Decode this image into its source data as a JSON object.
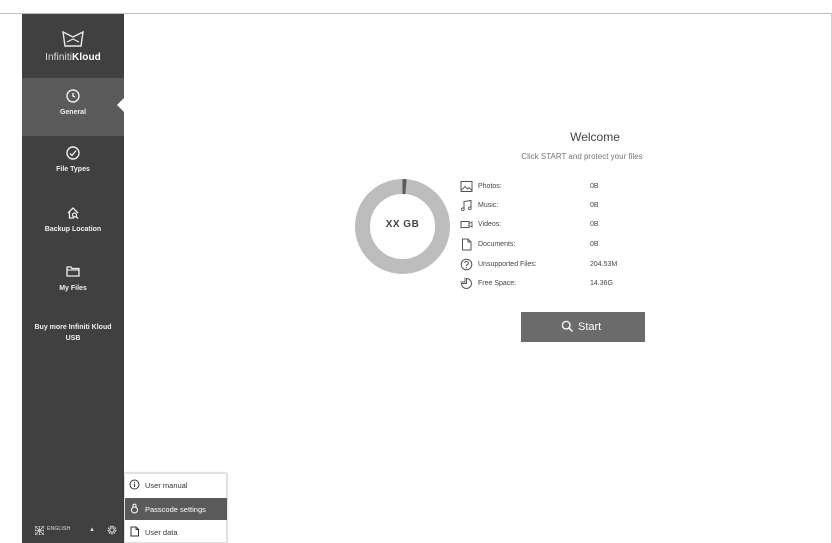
{
  "app": {
    "logo_prefix": "Infiniti",
    "logo_suffix": "Kloud"
  },
  "sidebar": {
    "items": [
      {
        "label": "General",
        "icon": "clock-icon",
        "active": true
      },
      {
        "label": "File Types",
        "icon": "check-circle-icon",
        "active": false
      },
      {
        "label": "Backup Location",
        "icon": "home-search-icon",
        "active": false
      },
      {
        "label": "My Files",
        "icon": "folder-icon",
        "active": false
      }
    ],
    "buy_more": "Buy more Infiniti Kloud USB",
    "language": "ENGLISH"
  },
  "popup_menu": {
    "items": [
      {
        "label": "User manual",
        "icon": "info-icon"
      },
      {
        "label": "Passcode settings",
        "icon": "lock-icon"
      },
      {
        "label": "User data",
        "icon": "document-icon"
      }
    ],
    "hovered_index": 1
  },
  "main": {
    "title": "Welcome",
    "subtitle": "Click START and protect your files",
    "donut_label": "XX GB",
    "used_fraction": 0.014,
    "stats": [
      {
        "label": "Photos:",
        "value": "0B",
        "icon": "image-icon"
      },
      {
        "label": "Music:",
        "value": "0B",
        "icon": "music-icon"
      },
      {
        "label": "Videos:",
        "value": "0B",
        "icon": "video-icon"
      },
      {
        "label": "Documents:",
        "value": "0B",
        "icon": "document-icon"
      },
      {
        "label": "Unsupported Files:",
        "value": "204.53M",
        "icon": "question-icon"
      },
      {
        "label": "Free Space:",
        "value": "14.36G",
        "icon": "pie-icon"
      }
    ],
    "start_label": "Start"
  },
  "colors": {
    "sidebar_bg": "#404040",
    "sidebar_active": "#5a5a5a",
    "donut_track": "#bdbdbd",
    "donut_used": "#5a5a5a",
    "button_bg": "#6b6b6b"
  }
}
